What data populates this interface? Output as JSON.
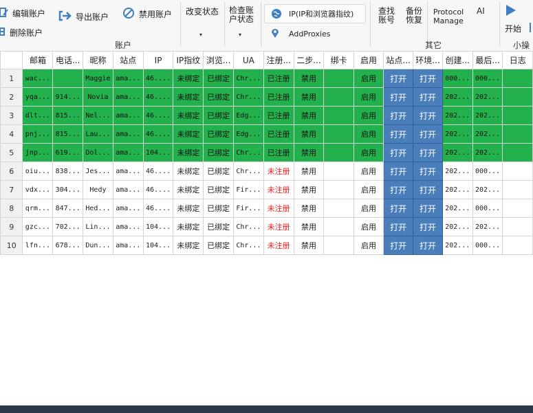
{
  "ribbon": {
    "account": {
      "edit": "编辑账户",
      "delete": "删除账户",
      "export": "导出账户",
      "disable": "禁用账户",
      "change_status": "改变状态",
      "check_status_l1": "检查账",
      "check_status_l2": "户状态",
      "group": "账户"
    },
    "ip_button": "IP(IP和浏览器指纹)",
    "add_proxies": "AddProxies",
    "other": {
      "find_l1": "查找",
      "find_l2": "账号",
      "backup_l1": "备份",
      "backup_l2": "恢复",
      "protocol_l1": "Protocol",
      "protocol_l2": "Manage",
      "ai": "AI",
      "group": "其它"
    },
    "start": "开始",
    "small_ops": "小操作",
    "icon_colors": {
      "blue": "#3d7fc1"
    }
  },
  "grid": {
    "headers": [
      "邮箱",
      "电话...",
      "昵称",
      "站点",
      "IP",
      "IP指纹",
      "浏览...",
      "UA",
      "注册...",
      "二步...",
      "绑卡",
      "启用",
      "站点...",
      "环境...",
      "创建...",
      "最后...",
      "日志"
    ],
    "rows": [
      {
        "n": "1",
        "green": true,
        "email": "wac...",
        "phone": "",
        "nick": "Maggie",
        "site": "ama...",
        "ip": "46....",
        "fp": "未绑定",
        "browser": "已绑定",
        "ua": "Chr...",
        "reg": "已注册",
        "twostep": "禁用",
        "card": "",
        "enabled": "启用",
        "site_btn": "打开",
        "env_btn": "打开",
        "created": "000...",
        "last": "000..."
      },
      {
        "n": "2",
        "green": true,
        "email": "yqa...",
        "phone": "914...",
        "nick": "Novia",
        "site": "ama...",
        "ip": "46....",
        "fp": "未绑定",
        "browser": "已绑定",
        "ua": "Chr...",
        "reg": "已注册",
        "twostep": "禁用",
        "card": "",
        "enabled": "启用",
        "site_btn": "打开",
        "env_btn": "打开",
        "created": "202...",
        "last": "202..."
      },
      {
        "n": "3",
        "green": true,
        "email": "dlt...",
        "phone": "815...",
        "nick": "Nel...",
        "site": "ama...",
        "ip": "46....",
        "fp": "未绑定",
        "browser": "已绑定",
        "ua": "Edg...",
        "reg": "已注册",
        "twostep": "禁用",
        "card": "",
        "enabled": "启用",
        "site_btn": "打开",
        "env_btn": "打开",
        "created": "202...",
        "last": "202..."
      },
      {
        "n": "4",
        "green": true,
        "email": "pnj...",
        "phone": "815...",
        "nick": "Lau...",
        "site": "ama...",
        "ip": "46....",
        "fp": "未绑定",
        "browser": "已绑定",
        "ua": "Edg...",
        "reg": "已注册",
        "twostep": "禁用",
        "card": "",
        "enabled": "启用",
        "site_btn": "打开",
        "env_btn": "打开",
        "created": "202...",
        "last": "202..."
      },
      {
        "n": "5",
        "green": true,
        "email": "jnp...",
        "phone": "619...",
        "nick": "Dol...",
        "site": "ama...",
        "ip": "104...",
        "fp": "未绑定",
        "browser": "已绑定",
        "ua": "Chr...",
        "reg": "已注册",
        "twostep": "禁用",
        "card": "",
        "enabled": "启用",
        "site_btn": "打开",
        "env_btn": "打开",
        "created": "202...",
        "last": "202..."
      },
      {
        "n": "6",
        "green": false,
        "email": "oiu...",
        "phone": "838...",
        "nick": "Jes...",
        "site": "ama...",
        "ip": "46....",
        "fp": "未绑定",
        "browser": "已绑定",
        "ua": "Chr...",
        "reg": "未注册",
        "twostep": "禁用",
        "card": "",
        "enabled": "启用",
        "site_btn": "打开",
        "env_btn": "打开",
        "created": "202...",
        "last": "000..."
      },
      {
        "n": "7",
        "green": false,
        "email": "vdx...",
        "phone": "304...",
        "nick": "Hedy",
        "site": "ama...",
        "ip": "46....",
        "fp": "未绑定",
        "browser": "已绑定",
        "ua": "Fir...",
        "reg": "未注册",
        "twostep": "禁用",
        "card": "",
        "enabled": "启用",
        "site_btn": "打开",
        "env_btn": "打开",
        "created": "202...",
        "last": "202..."
      },
      {
        "n": "8",
        "green": false,
        "email": "qrm...",
        "phone": "847...",
        "nick": "Hed...",
        "site": "ama...",
        "ip": "46....",
        "fp": "未绑定",
        "browser": "已绑定",
        "ua": "Fir...",
        "reg": "未注册",
        "twostep": "禁用",
        "card": "",
        "enabled": "启用",
        "site_btn": "打开",
        "env_btn": "打开",
        "created": "202...",
        "last": "000..."
      },
      {
        "n": "9",
        "green": false,
        "email": "gzc...",
        "phone": "702...",
        "nick": "Lin...",
        "site": "ama...",
        "ip": "104...",
        "fp": "未绑定",
        "browser": "已绑定",
        "ua": "Chr...",
        "reg": "未注册",
        "twostep": "禁用",
        "card": "",
        "enabled": "启用",
        "site_btn": "打开",
        "env_btn": "打开",
        "created": "202...",
        "last": "202..."
      },
      {
        "n": "10",
        "green": false,
        "email": "lfn...",
        "phone": "678...",
        "nick": "Dun...",
        "site": "ama...",
        "ip": "104...",
        "fp": "未绑定",
        "browser": "已绑定",
        "ua": "Chr...",
        "reg": "未注册",
        "twostep": "禁用",
        "card": "",
        "enabled": "启用",
        "site_btn": "打开",
        "env_btn": "打开",
        "created": "202...",
        "last": "000..."
      }
    ]
  }
}
